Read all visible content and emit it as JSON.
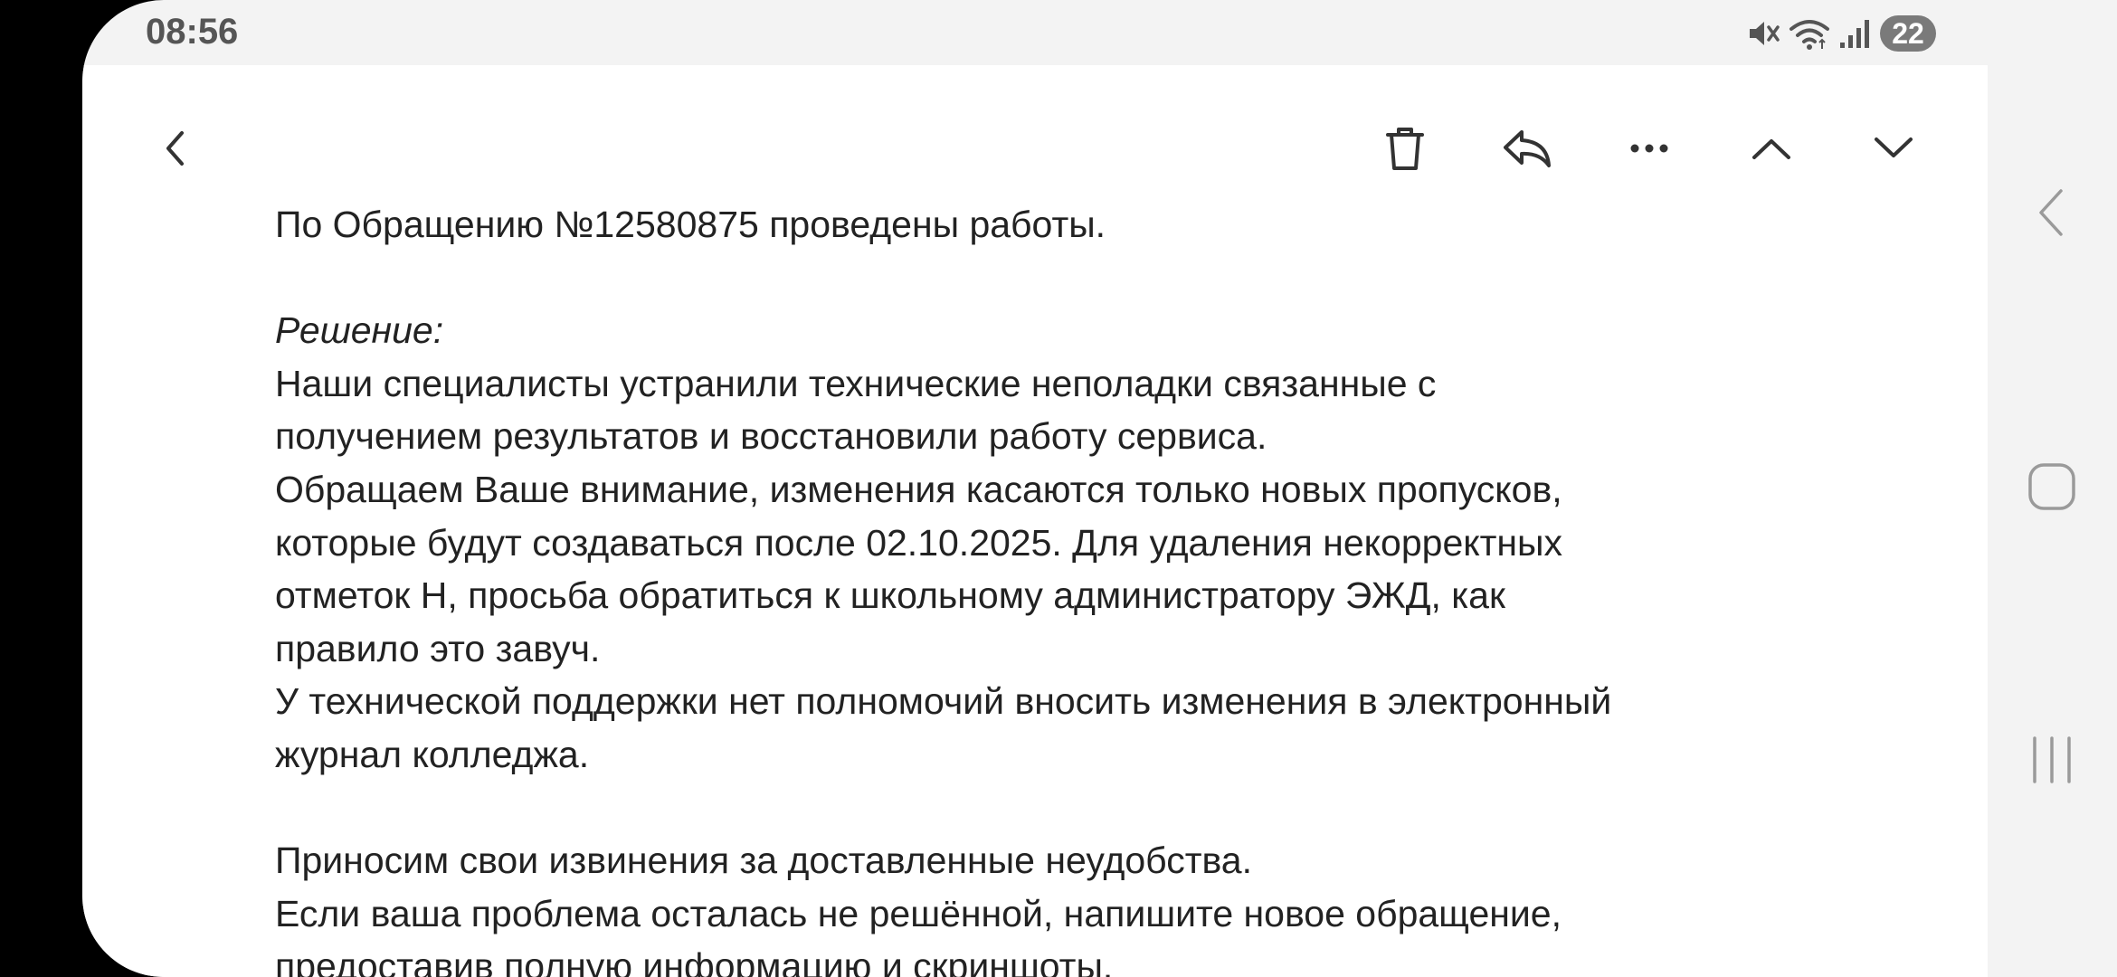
{
  "status_bar": {
    "time": "08:56",
    "battery": "22",
    "icons": [
      "mute-icon",
      "wifi-icon",
      "signal-icon"
    ]
  },
  "toolbar": {
    "icons": [
      "back-icon",
      "delete-icon",
      "reply-icon",
      "more-icon",
      "previous-icon",
      "next-icon"
    ]
  },
  "message": {
    "lines": [
      "По Обращению №12580875 проведены работы.",
      "",
      "Решение:",
      "Наши специалисты устранили технические неполадки связанные с",
      "получением результатов и восстановили работу сервиса.",
      "Обращаем Ваше внимание, изменения касаются только новых пропусков,",
      "которые будут создаваться после 02.10.2025. Для удаления некорректных",
      "отметок Н, просьба обратиться к школьному администратору ЭЖД, как",
      "правило это завуч.",
      "У технической поддержки нет полномочий вносить изменения в электронный",
      "журнал колледжа.",
      "",
      "Приносим свои извинения за доставленные неудобства.",
      "Если ваша проблема осталась не решённой, напишите новое обращение,",
      "предоставив полную информацию и скриншоты."
    ]
  },
  "nav_bar": {
    "icons": [
      "nav-back-icon",
      "home-icon",
      "recents-icon"
    ]
  },
  "colors": {
    "panel": "#ffffff",
    "background": "#f3f3f3",
    "text": "#222222",
    "icon": "#333333",
    "battery_badge": "#7a7a7a"
  }
}
